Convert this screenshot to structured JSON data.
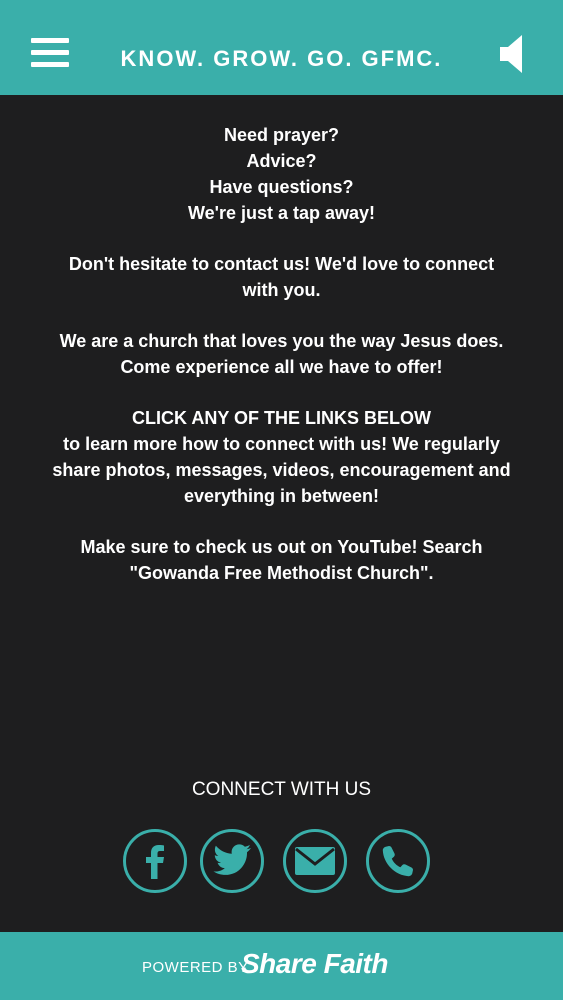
{
  "header": {
    "title": "KNOW. GROW. GO. GFMC.",
    "menu_icon": "hamburger-icon",
    "speaker_icon": "speaker-icon"
  },
  "content": {
    "paragraphs": [
      [
        "Need prayer?",
        "Advice?",
        "Have questions?",
        "We're just a tap away!"
      ],
      [
        "Don't hesitate to contact us!  We'd love to connect",
        "with you."
      ],
      [
        "We are a church that loves you the way Jesus does.",
        "Come experience all we have to offer!"
      ],
      [
        "CLICK ANY OF THE LINKS BELOW",
        "to learn more how to connect with us!  We regularly",
        "share photos, messages, videos, encouragement and",
        "everything in between!"
      ],
      [
        "Make sure to check us out on YouTube!  Search",
        "\"Gowanda Free Methodist Church\"."
      ]
    ]
  },
  "connect": {
    "title": "CONNECT WITH US",
    "social": [
      "facebook-icon",
      "twitter-icon",
      "email-icon",
      "phone-icon"
    ]
  },
  "footer": {
    "powered": "POWERED BY",
    "brand": "Share Faith"
  },
  "colors": {
    "accent": "#3aafaa",
    "background": "#1e1e1f",
    "text": "#ffffff"
  }
}
